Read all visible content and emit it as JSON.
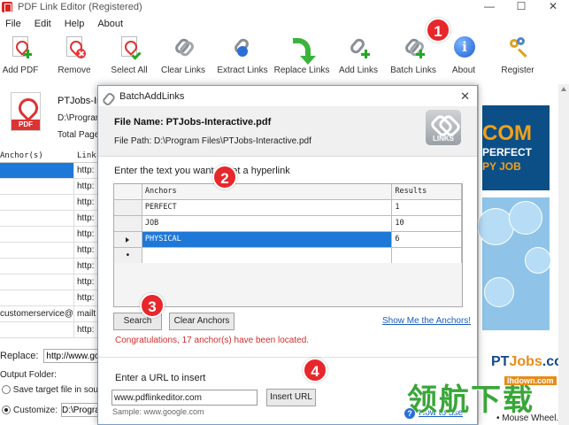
{
  "window": {
    "title": "PDF Link Editor (Registered)",
    "minimize": "—",
    "maximize": "☐",
    "close": "✕"
  },
  "menu": [
    "File",
    "Edit",
    "Help",
    "About"
  ],
  "toolbar": {
    "add_pdf": "Add PDF",
    "remove": "Remove",
    "select_all": "Select All",
    "clear_links": "Clear Links",
    "extract_links": "Extract Links",
    "replace_links": "Replace Links",
    "add_links": "Add Links",
    "batch_links": "Batch Links",
    "about": "About",
    "register": "Register"
  },
  "file_info": {
    "name": "PTJobs-In",
    "path": "D:\\Program",
    "total": "Total Page",
    "pdf_badge": "PDF"
  },
  "left_grid": {
    "col_anchor": "Anchor(s)",
    "col_link": "Link",
    "rows": [
      {
        "anchor": "",
        "link": "http:"
      },
      {
        "anchor": "",
        "link": "http:"
      },
      {
        "anchor": "",
        "link": "http:"
      },
      {
        "anchor": "",
        "link": "http:"
      },
      {
        "anchor": "",
        "link": "http:"
      },
      {
        "anchor": "",
        "link": "http:"
      },
      {
        "anchor": "",
        "link": "http:"
      },
      {
        "anchor": "",
        "link": "http:"
      },
      {
        "anchor": "",
        "link": "http:"
      },
      {
        "anchor": "customerservice@...",
        "link": "mailt"
      },
      {
        "anchor": "",
        "link": "http:"
      }
    ]
  },
  "replace": {
    "label": "Replace:",
    "value": "http://www.goo"
  },
  "output": {
    "label": "Output Folder:",
    "save_option": "Save target file in sourc",
    "custom_option": "Customize:",
    "custom_value": "D:\\Progra"
  },
  "preview": {
    "ad_com": "COM",
    "ad_line1": "PERFECT",
    "ad_line2": "PY JOB",
    "pt_logo_a": "PT",
    "pt_logo_b": "Jobs",
    "pt_logo_c": ".com",
    "mouse_text": "• Mouse Wheel."
  },
  "dialog": {
    "title": "BatchAddLinks",
    "close": "✕",
    "file_name_label": "File Name: PTJobs-Interactive.pdf",
    "file_path_label": "File Path: D:\\Program Files\\PTJobs-Interactive.pdf",
    "logo_text": "LINKS",
    "prompt": "Enter the text you want to set a hyperlink",
    "grid": {
      "col_anchors": "Anchors",
      "col_results": "Results",
      "rows": [
        {
          "anchor": "PERFECT",
          "result": "1"
        },
        {
          "anchor": "JOB",
          "result": "10"
        },
        {
          "anchor": "PHYSICAL",
          "result": "6"
        },
        {
          "anchor": "",
          "result": ""
        }
      ]
    },
    "search_button": "Search",
    "clear_button": "Clear Anchors",
    "show_link": "Show Me the Anchors!",
    "congrats": "Congratulations, 17 anchor(s) have been located.",
    "url_label": "Enter a URL to insert",
    "url_value": "www.pdflinkeditor.com",
    "insert_button": "Insert URL",
    "sample": "Sample: www.google.com",
    "help_link": "How to use"
  },
  "markers": [
    "1",
    "2",
    "3",
    "4"
  ],
  "watermark": {
    "main": "领航下载",
    "site": "lhdown.com"
  },
  "colors": {
    "accent": "#1e78d8",
    "marker": "#e8272c",
    "success_text": "#d12c2c"
  }
}
